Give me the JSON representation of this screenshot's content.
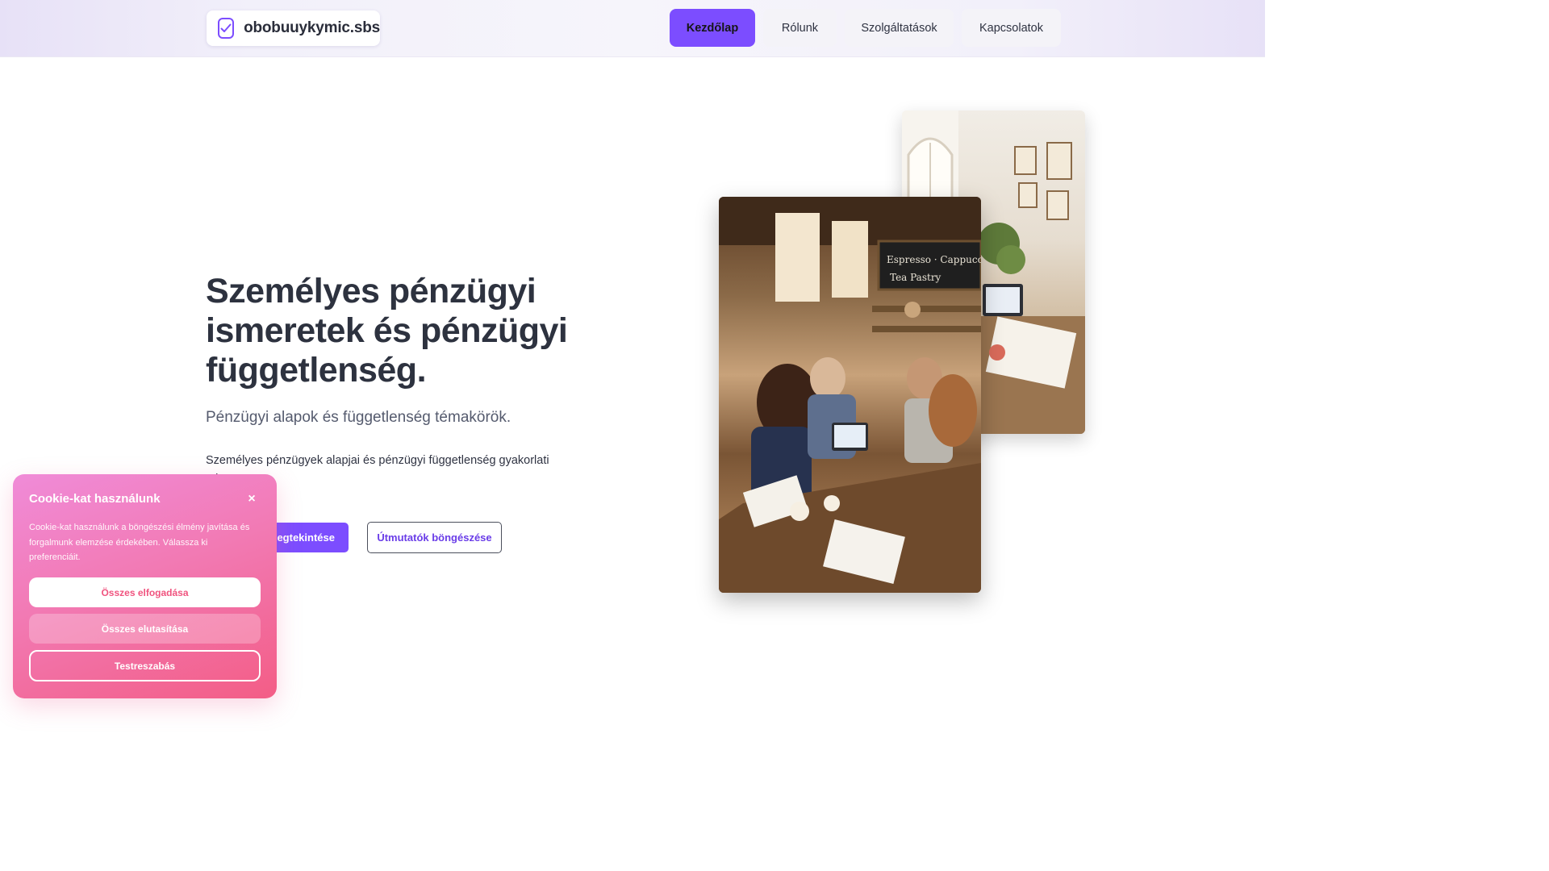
{
  "header": {
    "logo_text": "obobuuykymic.sbs",
    "nav": [
      {
        "label": "Kezdőlap",
        "active": true
      },
      {
        "label": "Rólunk",
        "active": false
      },
      {
        "label": "Szolgáltatások",
        "active": false
      },
      {
        "label": "Kapcsolatok",
        "active": false
      }
    ]
  },
  "hero": {
    "title": "Személyes pénzügyi ismeretek és pénzügyi függetlenség.",
    "subtitle": "Pénzügyi alapok és függetlenség témakörök.",
    "description": "Személyes pénzügyek alapjai és pénzügyi függetlenség gyakorlati ...l.",
    "primary_button": "...megtekintése",
    "secondary_button": "Útmutatók böngészése"
  },
  "cookie": {
    "title": "Cookie-kat használunk",
    "close_symbol": "×",
    "text": "Cookie-kat használunk a böngészési élmény javítása és forgalmunk elemzése érdekében. Válassza ki preferenciáit.",
    "accept": "Összes elfogadása",
    "reject": "Összes elutasítása",
    "customize": "Testreszabás"
  },
  "colors": {
    "accent": "#7c4dff",
    "cookie_gradient_start": "#f08bd8",
    "cookie_gradient_end": "#f35d86"
  },
  "icons": {
    "logo": "checkbox-check-icon"
  }
}
